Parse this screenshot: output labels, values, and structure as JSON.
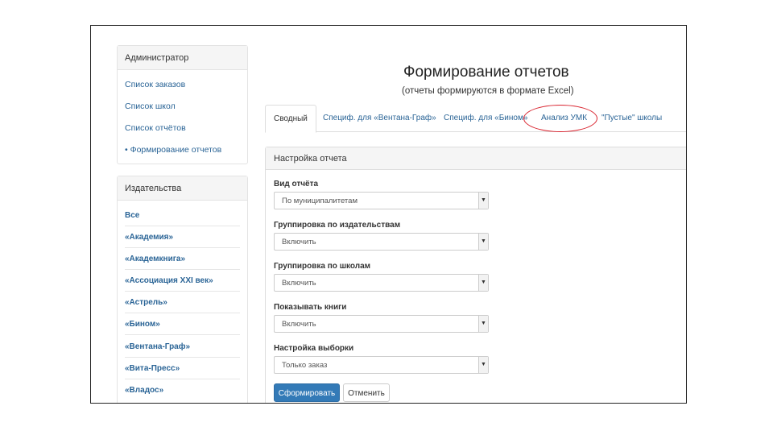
{
  "sidebar": {
    "admin": {
      "title": "Администратор",
      "links": [
        "Список заказов",
        "Список школ",
        "Список отчётов",
        "• Формирование отчетов"
      ]
    },
    "publishers": {
      "title": "Издательства",
      "links": [
        "Все",
        "«Академия»",
        "«Академкнига»",
        "«Ассоциация XXI век»",
        "«Астрель»",
        "«Бином»",
        "«Вентана-Граф»",
        "«Вита-Пресс»",
        "«Владос»"
      ]
    }
  },
  "page": {
    "title": "Формирование отчетов",
    "subtitle": "(отчеты формируются в формате Excel)"
  },
  "tabs": [
    "Сводный",
    "Специф. для «Вентана-Граф»",
    "Специф. для «Бином»",
    "Анализ УМК",
    "\"Пустые\" школы"
  ],
  "settings": {
    "title": "Настройка отчета",
    "fields": [
      {
        "label": "Вид отчёта",
        "value": "По муниципалитетам"
      },
      {
        "label": "Группировка по издательствам",
        "value": "Включить"
      },
      {
        "label": "Группировка по школам",
        "value": "Включить"
      },
      {
        "label": "Показывать книги",
        "value": "Включить"
      },
      {
        "label": "Настройка выборки",
        "value": "Только заказ"
      }
    ],
    "submit_label": "Сформировать",
    "cancel_label": "Отменить"
  },
  "colors": {
    "accent": "#337ab7",
    "link": "#2a6496",
    "highlight_ring": "#d9232e"
  }
}
